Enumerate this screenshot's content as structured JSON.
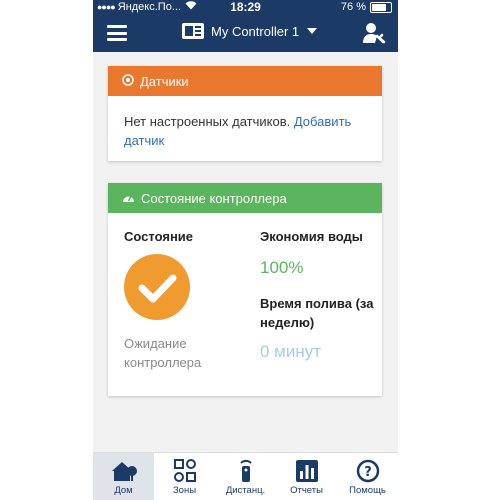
{
  "status_bar": {
    "carrier": "Яндекс.По...",
    "time": "18:29",
    "battery": "76 %"
  },
  "top_bar": {
    "controller_name": "My Controller 1"
  },
  "sensors_card": {
    "title": "Датчики",
    "message": "Нет настроенных датчиков. ",
    "add_link": "Добавить датчик"
  },
  "controller_card": {
    "title": "Состояние контроллера",
    "state_label": "Состояние",
    "state_text": "Ожидание контроллера",
    "water_label": "Экономия воды",
    "water_value": "100%",
    "watering_label": "Время полива (за неделю)",
    "watering_value": "0 минут"
  },
  "tabs": [
    {
      "label": "Дом",
      "icon": "home-icon",
      "active": true
    },
    {
      "label": "Зоны",
      "icon": "zones-icon",
      "active": false
    },
    {
      "label": "Дистанц.",
      "icon": "remote-icon",
      "active": false
    },
    {
      "label": "Отчеты",
      "icon": "reports-icon",
      "active": false
    },
    {
      "label": "Помощь",
      "icon": "help-icon",
      "active": false
    }
  ],
  "colors": {
    "header": "#1c3a66",
    "sensors_accent": "#e9772e",
    "controller_accent": "#5bb55e",
    "status_badge": "#ef9b30",
    "link": "#2c6fb4"
  }
}
